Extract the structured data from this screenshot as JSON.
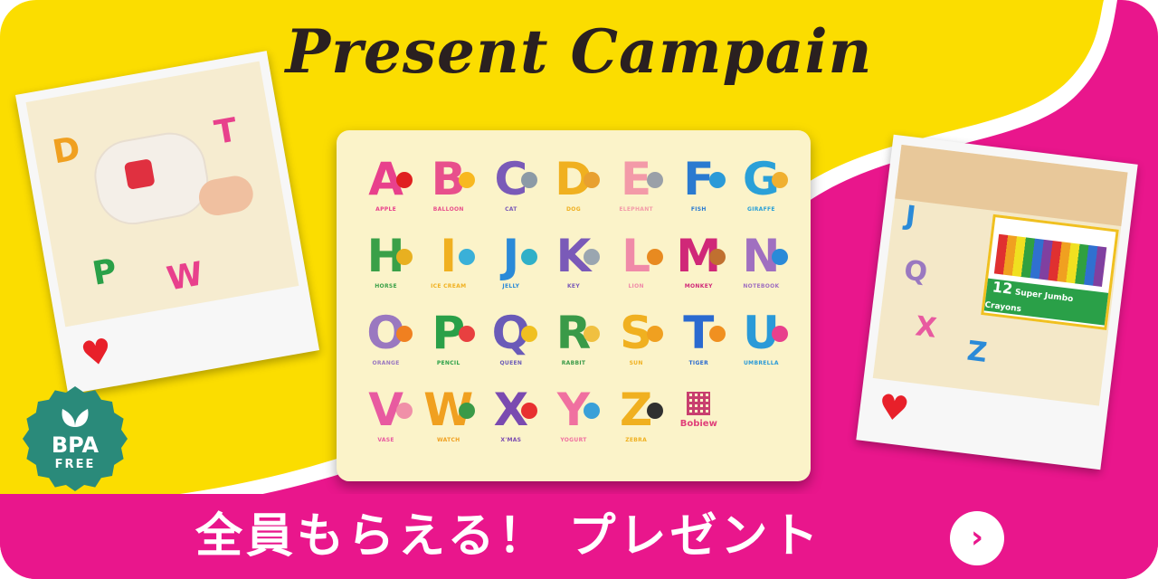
{
  "title": "Present Campain",
  "mat": {
    "letters": [
      {
        "char": "A",
        "word": "APPLE",
        "color": "#e8408c",
        "deco": "#e02020"
      },
      {
        "char": "B",
        "word": "BALLOON",
        "color": "#e84f8c",
        "deco": "#f8b820"
      },
      {
        "char": "C",
        "word": "CAT",
        "color": "#7a5ab8",
        "deco": "#8c9aa6"
      },
      {
        "char": "D",
        "word": "DOG",
        "color": "#f0b020",
        "deco": "#e8a030"
      },
      {
        "char": "E",
        "word": "ELEPHANT",
        "color": "#f39aa8",
        "deco": "#9aa0a8"
      },
      {
        "char": "F",
        "word": "FISH",
        "color": "#2a7ad0",
        "deco": "#2a9ad8"
      },
      {
        "char": "G",
        "word": "GIRAFFE",
        "color": "#2aa0d8",
        "deco": "#f0b030"
      },
      {
        "char": "H",
        "word": "HORSE",
        "color": "#3aa048",
        "deco": "#e8b020"
      },
      {
        "char": "I",
        "word": "ICE CREAM",
        "color": "#f0b020",
        "deco": "#3ab0d8"
      },
      {
        "char": "J",
        "word": "JELLY",
        "color": "#2a8ad8",
        "deco": "#30b0c8"
      },
      {
        "char": "K",
        "word": "KEY",
        "color": "#7a5ab8",
        "deco": "#9aa6b0"
      },
      {
        "char": "L",
        "word": "LION",
        "color": "#f08aa8",
        "deco": "#e88a20"
      },
      {
        "char": "M",
        "word": "MONKEY",
        "color": "#d02878",
        "deco": "#c07030"
      },
      {
        "char": "N",
        "word": "NOTEBOOK",
        "color": "#a070c0",
        "deco": "#2a8ad8"
      },
      {
        "char": "O",
        "word": "ORANGE",
        "color": "#9a78c0",
        "deco": "#f08020"
      },
      {
        "char": "P",
        "word": "PENCIL",
        "color": "#2aa048",
        "deco": "#e84040"
      },
      {
        "char": "Q",
        "word": "QUEEN",
        "color": "#6a5ab8",
        "deco": "#f0c020"
      },
      {
        "char": "R",
        "word": "RABBIT",
        "color": "#3a9a48",
        "deco": "#f0c040"
      },
      {
        "char": "S",
        "word": "SUN",
        "color": "#f0b020",
        "deco": "#f0a020"
      },
      {
        "char": "T",
        "word": "TIGER",
        "color": "#2a6ad0",
        "deco": "#f09020"
      },
      {
        "char": "U",
        "word": "UMBRELLA",
        "color": "#2a9ad8",
        "deco": "#e8408c"
      },
      {
        "char": "V",
        "word": "VASE",
        "color": "#e85aa0",
        "deco": "#f090a8"
      },
      {
        "char": "W",
        "word": "WATCH",
        "color": "#f0a020",
        "deco": "#3a9a48"
      },
      {
        "char": "X",
        "word": "X'MAS",
        "color": "#7a4ab0",
        "deco": "#e83030"
      },
      {
        "char": "Y",
        "word": "YOGURT",
        "color": "#f070a0",
        "deco": "#3aa0d8"
      },
      {
        "char": "Z",
        "word": "ZEBRA",
        "color": "#f0b020",
        "deco": "#303030"
      }
    ],
    "brand": "Bobiew"
  },
  "crayon_box": {
    "count": "12",
    "label": "Super Jumbo Crayons"
  },
  "badge": {
    "line1": "BPA",
    "line2": "FREE"
  },
  "cta": {
    "label": "全員もらえる！ プレゼント",
    "arrow": "›"
  },
  "colors": {
    "yellow": "#fbdd00",
    "pink": "#e9168c",
    "badge": "#2a8a7a",
    "mat": "#fbf3c9"
  }
}
